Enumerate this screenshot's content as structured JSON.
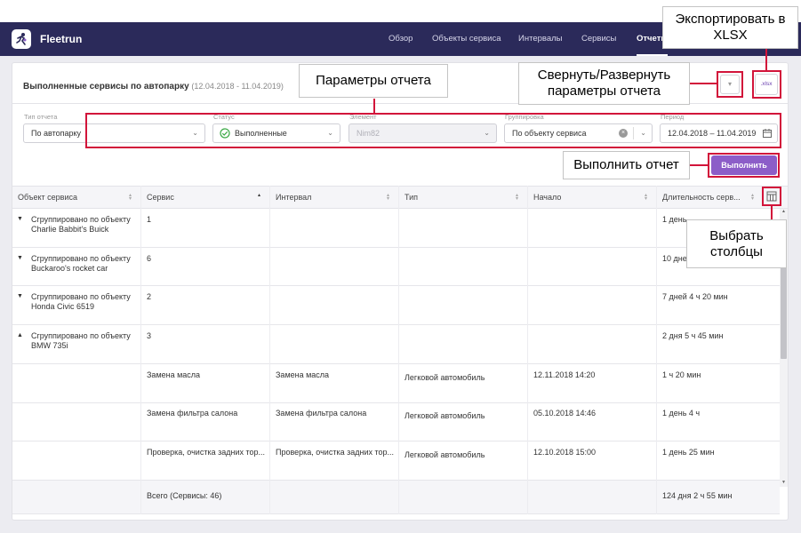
{
  "app": {
    "brand": "Fleetrun"
  },
  "nav": [
    "Обзор",
    "Объекты сервиса",
    "Интервалы",
    "Сервисы",
    "Отчеты"
  ],
  "report": {
    "title": "Выполненные сервисы по автопарку",
    "range": "(12.04.2018 - 11.04.2019)",
    "xlsx_label": ".xlsx"
  },
  "filters": {
    "type": {
      "label": "Тип отчета",
      "value": "По автопарку"
    },
    "status": {
      "label": "Статус",
      "value": "Выполненные"
    },
    "element": {
      "label": "Элемент",
      "value": "Nim82"
    },
    "grouping": {
      "label": "Группировка",
      "value": "По объекту сервиса"
    },
    "period": {
      "label": "Период",
      "value": "12.04.2018 – 11.04.2019"
    }
  },
  "run_button": "Выполнить",
  "table": {
    "headers": [
      "Объект сервиса",
      "Сервис",
      "Интервал",
      "Тип",
      "Начало",
      "Длительность серв..."
    ],
    "groups": [
      {
        "line1": "Сгруппировано по объекту",
        "line2": "Charlie Babbit's Buick",
        "count": "1",
        "duration": "1 день"
      },
      {
        "line1": "Сгруппировано по объекту",
        "line2": "Buckaroo's rocket car",
        "count": "6",
        "duration": "10 дне"
      },
      {
        "line1": "Сгруппировано по объекту",
        "line2": "Honda Civic 6519",
        "count": "2",
        "duration": "7 дней 4 ч 20 мин"
      },
      {
        "line1": "Сгруппировано по объекту",
        "line2": "BMW 735i",
        "count": "3",
        "duration": "2 дня 5 ч 45 мин"
      }
    ],
    "details": [
      {
        "service": "Замена масла",
        "interval": "Замена масла",
        "type": "Легковой автомобиль",
        "start": "12.11.2018 14:20",
        "duration": "1 ч 20 мин"
      },
      {
        "service": "Замена фильтра салона",
        "interval": "Замена фильтра салона",
        "type": "Легковой автомобиль",
        "start": "05.10.2018 14:46",
        "duration": "1 день 4 ч"
      },
      {
        "service": "Проверка, очистка задних тор...",
        "interval": "Проверка, очистка задних тор...",
        "type": "Легковой автомобиль",
        "start": "12.10.2018 15:00",
        "duration": "1 день 25 мин"
      }
    ],
    "total": {
      "label": "Всего (Сервисы: 46)",
      "duration": "124 дня 2 ч 55 мин"
    }
  },
  "callouts": {
    "export": "Экспортировать в XLSX",
    "params": "Параметры отчета",
    "collapse": "Свернуть/Развернуть параметры отчета",
    "run": "Выполнить отчет",
    "columns": "Выбрать столбцы"
  },
  "colors": {
    "header_bg": "#2b2a5a",
    "accent": "#8c5dc8",
    "highlight": "#d2143a",
    "status_ok": "#3aa845"
  }
}
